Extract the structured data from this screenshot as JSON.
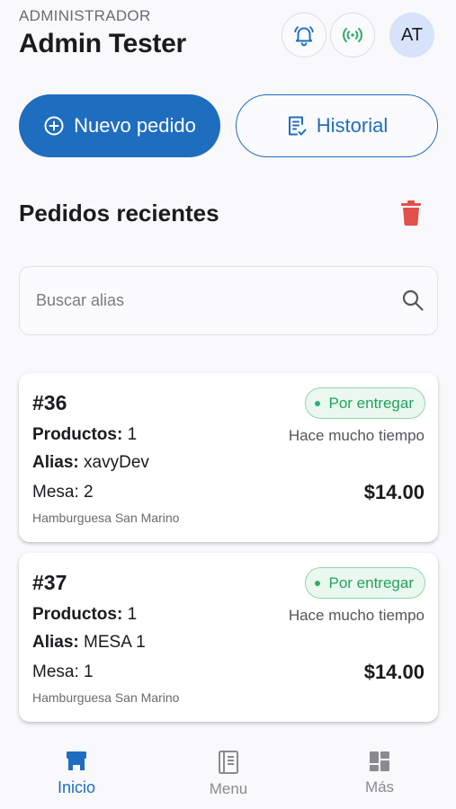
{
  "header": {
    "role": "ADMINISTRADOR",
    "user_name": "Admin Tester",
    "avatar_initials": "AT",
    "bell_icon": "bell-ringing-icon",
    "signal_icon": "broadcast-signal-icon"
  },
  "actions": {
    "new_order_label": "Nuevo pedido",
    "new_order_icon": "plus-circle-icon",
    "history_label": "Historial",
    "history_icon": "receipt-check-icon"
  },
  "section": {
    "title": "Pedidos recientes",
    "delete_icon": "trash-icon"
  },
  "search": {
    "placeholder": "Buscar alias",
    "value": ""
  },
  "orders": [
    {
      "number": "#36",
      "status": "Por entregar",
      "products_label": "Productos:",
      "products_count": "1",
      "time": "Hace mucho tiempo",
      "alias_label": "Alias:",
      "alias": "xavyDev",
      "table_label": "Mesa:",
      "table": "2",
      "price": "$14.00",
      "item": "Hamburguesa San Marino"
    },
    {
      "number": "#37",
      "status": "Por entregar",
      "products_label": "Productos:",
      "products_count": "1",
      "time": "Hace mucho tiempo",
      "alias_label": "Alias:",
      "alias": "MESA 1",
      "table_label": "Mesa:",
      "table": "1",
      "price": "$14.00",
      "item": "Hamburguesa San Marino"
    }
  ],
  "nav": {
    "home_label": "Inicio",
    "menu_label": "Menu",
    "more_label": "Más"
  },
  "colors": {
    "primary": "#1f6dbf",
    "status_green": "#22a35d",
    "danger": "#e2504a",
    "avatar_bg": "#d6e3fb"
  }
}
